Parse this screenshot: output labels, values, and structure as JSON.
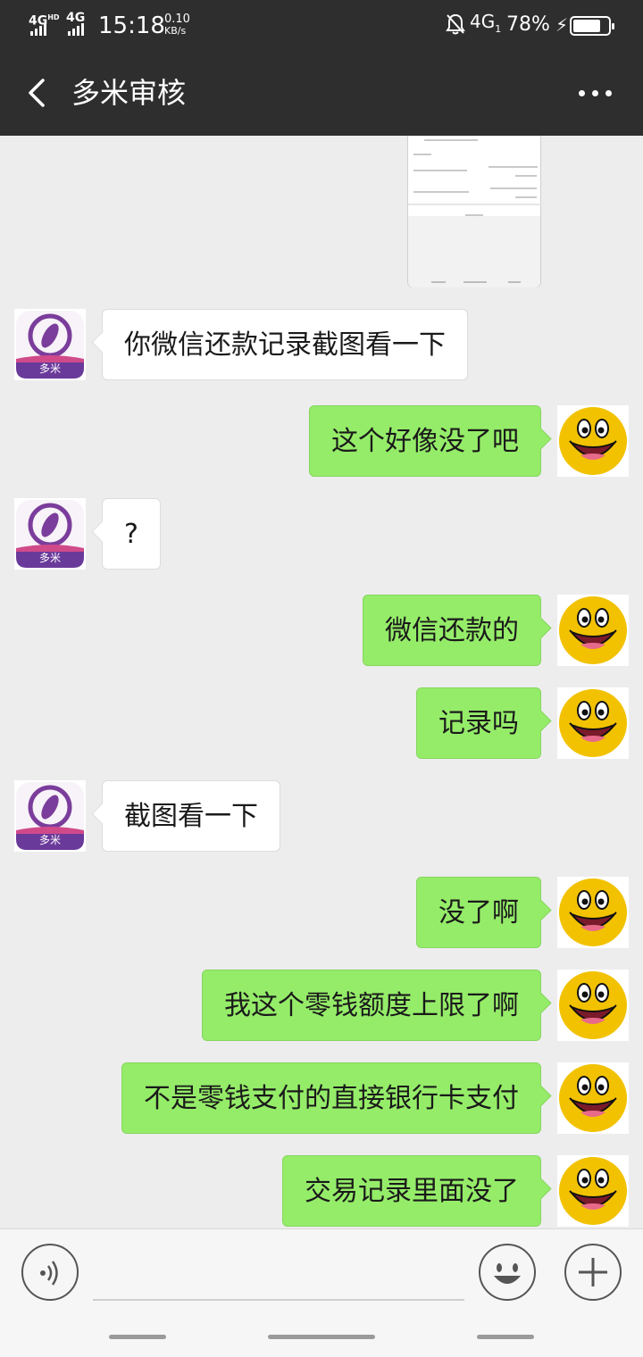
{
  "status_bar": {
    "net_left_1": "4G",
    "net_left_1_sup": "HD",
    "net_left_2": "4G",
    "time": "15:18",
    "speed_value": "0.10",
    "speed_unit": "KB/s",
    "net_right": "4G",
    "net_right_sub": "1",
    "battery_percent": "78%",
    "battery_level": 0.78,
    "icons": [
      "signal-icon",
      "signal-icon",
      "mute-bell-icon",
      "charging-icon",
      "battery-icon"
    ]
  },
  "navbar": {
    "back_icon": "chevron-left-icon",
    "title": "多米审核",
    "more_icon": "more-dots-icon"
  },
  "messages": [
    {
      "side": "left",
      "sender_avatar": "duomi-logo",
      "text": "你微信还款记录截图看一下"
    },
    {
      "side": "right",
      "sender_avatar": "smiley-avatar",
      "text": "这个好像没了吧"
    },
    {
      "side": "left",
      "sender_avatar": "duomi-logo",
      "text": "?"
    },
    {
      "side": "right",
      "sender_avatar": "smiley-avatar",
      "text": "微信还款的"
    },
    {
      "side": "right",
      "sender_avatar": "smiley-avatar",
      "text": "记录吗"
    },
    {
      "side": "left",
      "sender_avatar": "duomi-logo",
      "text": "截图看一下"
    },
    {
      "side": "right",
      "sender_avatar": "smiley-avatar",
      "text": "没了啊"
    },
    {
      "side": "right",
      "sender_avatar": "smiley-avatar",
      "text": "我这个零钱额度上限了啊"
    },
    {
      "side": "right",
      "sender_avatar": "smiley-avatar",
      "text": "不是零钱支付的直接银行卡支付"
    },
    {
      "side": "right",
      "sender_avatar": "smiley-avatar",
      "text": "交易记录里面没了"
    }
  ],
  "avatar_logo_text": "多米",
  "input_bar": {
    "voice_icon": "voice-icon",
    "input_value": "",
    "emoji_icon": "emoji-icon",
    "add_icon": "plus-icon"
  },
  "colors": {
    "header_bg": "#2e2e2e",
    "chat_bg": "#ededed",
    "sent_bubble": "#95ec69",
    "received_bubble": "#ffffff",
    "logo_purple": "#7b3d9b"
  }
}
